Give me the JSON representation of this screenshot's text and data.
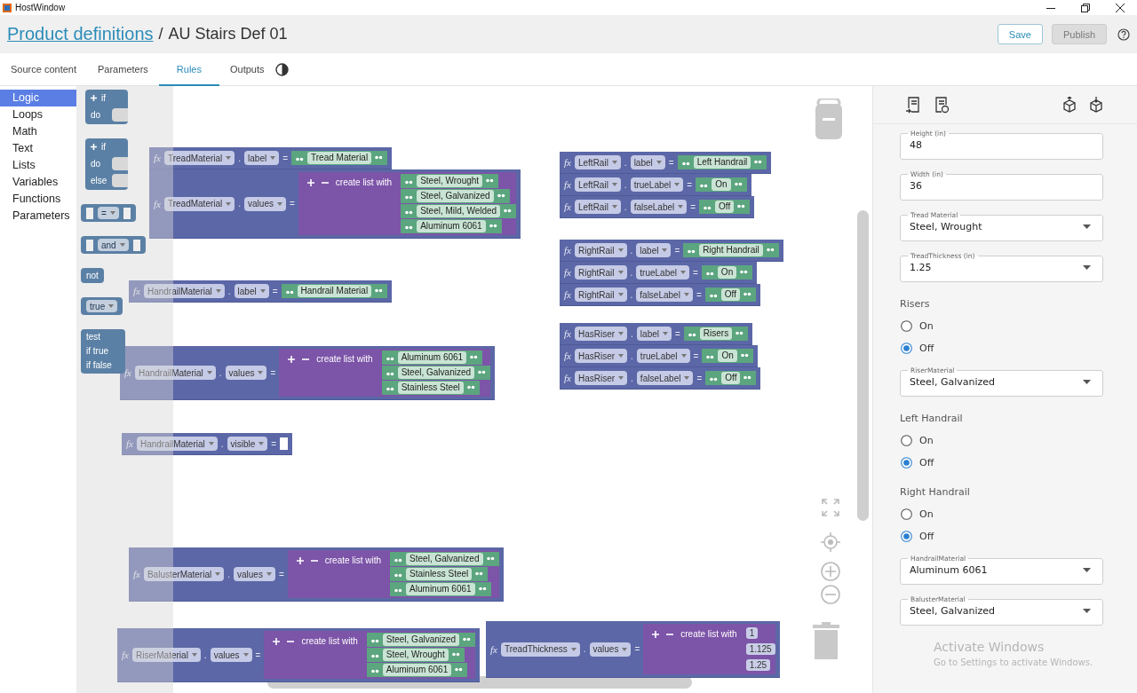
{
  "window": {
    "title": "HostWindow"
  },
  "header": {
    "link": "Product definitions",
    "separator": "/",
    "title": "AU Stairs Def 01",
    "buttons": [
      {
        "label": "Save",
        "disabled": false
      },
      {
        "label": "Publish",
        "disabled": true
      }
    ]
  },
  "tabs": [
    {
      "label": "Source content",
      "selected": false
    },
    {
      "label": "Parameters",
      "selected": false
    },
    {
      "label": "Rules",
      "selected": true
    },
    {
      "label": "Outputs",
      "selected": false
    }
  ],
  "toolbox": [
    {
      "label": "Logic",
      "selected": true
    },
    {
      "label": "Loops",
      "selected": false
    },
    {
      "label": "Math",
      "selected": false
    },
    {
      "label": "Text",
      "selected": false
    },
    {
      "label": "Lists",
      "selected": false
    },
    {
      "label": "Variables",
      "selected": false
    },
    {
      "label": "Functions",
      "selected": false
    },
    {
      "label": "Parameters",
      "selected": false
    }
  ],
  "flyout": [
    {
      "kind": "if",
      "labels": [
        "if",
        "do"
      ]
    },
    {
      "kind": "if_else",
      "labels": [
        "if",
        "do",
        "else"
      ]
    },
    {
      "kind": "compare",
      "op": "="
    },
    {
      "kind": "logic_op",
      "op": "and"
    },
    {
      "kind": "not",
      "label": "not"
    },
    {
      "kind": "boolean",
      "value": "true"
    },
    {
      "kind": "ternary",
      "labels": [
        "test",
        "if true",
        "if false"
      ]
    }
  ],
  "canvas": {
    "groups": [
      {
        "rows": [
          {
            "icon": "fx",
            "object": "TreadMaterial",
            "dot": ".",
            "property": "label",
            "op": "=",
            "value": {
              "kind": "text",
              "text": "Tread Material"
            }
          },
          {
            "icon": "fx",
            "object": "TreadMaterial",
            "dot": ".",
            "property": "values",
            "op": "=",
            "value": {
              "kind": "list",
              "label": "create list with",
              "items": [
                {
                  "kind": "text",
                  "text": "Steel, Wrought"
                },
                {
                  "kind": "text",
                  "text": "Steel, Galvanized"
                },
                {
                  "kind": "text",
                  "text": "Steel, Mild, Welded"
                },
                {
                  "kind": "text",
                  "text": "Aluminum 6061"
                }
              ]
            }
          }
        ]
      },
      {
        "rows": [
          {
            "icon": "fx",
            "object": "HandrailMaterial",
            "dot": ".",
            "property": "label",
            "op": "=",
            "value": {
              "kind": "text",
              "text": "Handrail Material"
            }
          }
        ]
      },
      {
        "rows": [
          {
            "icon": "fx",
            "object": "HandrailMaterial",
            "dot": ".",
            "property": "values",
            "op": "=",
            "value": {
              "kind": "list",
              "label": "create list with",
              "items": [
                {
                  "kind": "text",
                  "text": "Aluminum 6061"
                },
                {
                  "kind": "text",
                  "text": "Steel, Galvanized"
                },
                {
                  "kind": "text",
                  "text": "Stainless Steel"
                }
              ]
            }
          }
        ]
      },
      {
        "rows": [
          {
            "icon": "fx",
            "object": "HandrailMaterial",
            "dot": ".",
            "property": "visible",
            "op": "=",
            "value": {
              "kind": "empty"
            }
          }
        ]
      },
      {
        "rows": [
          {
            "icon": "fx",
            "object": "BalusterMaterial",
            "dot": ".",
            "property": "values",
            "op": "=",
            "value": {
              "kind": "list",
              "label": "create list with",
              "items": [
                {
                  "kind": "text",
                  "text": "Steel, Galvanized"
                },
                {
                  "kind": "text",
                  "text": "Stainless Steel"
                },
                {
                  "kind": "text",
                  "text": "Aluminum 6061"
                }
              ]
            }
          }
        ]
      },
      {
        "rows": [
          {
            "icon": "fx",
            "object": "RiserMaterial",
            "dot": ".",
            "property": "values",
            "op": "=",
            "value": {
              "kind": "list",
              "label": "create list with",
              "items": [
                {
                  "kind": "text",
                  "text": "Steel, Galvanized"
                },
                {
                  "kind": "text",
                  "text": "Steel, Wrought"
                },
                {
                  "kind": "text",
                  "text": "Aluminum 6061"
                }
              ]
            }
          }
        ]
      },
      {
        "rows": [
          {
            "icon": "fx",
            "object": "LeftRail",
            "dot": ".",
            "property": "label",
            "op": "=",
            "value": {
              "kind": "text",
              "text": "Left Handrail"
            }
          },
          {
            "icon": "fx",
            "object": "LeftRail",
            "dot": ".",
            "property": "trueLabel",
            "op": "=",
            "value": {
              "kind": "text",
              "text": "On"
            }
          },
          {
            "icon": "fx",
            "object": "LeftRail",
            "dot": ".",
            "property": "falseLabel",
            "op": "=",
            "value": {
              "kind": "text",
              "text": "Off"
            }
          }
        ]
      },
      {
        "rows": [
          {
            "icon": "fx",
            "object": "RightRail",
            "dot": ".",
            "property": "label",
            "op": "=",
            "value": {
              "kind": "text",
              "text": "Right Handrail"
            }
          },
          {
            "icon": "fx",
            "object": "RightRail",
            "dot": ".",
            "property": "trueLabel",
            "op": "=",
            "value": {
              "kind": "text",
              "text": "On"
            }
          },
          {
            "icon": "fx",
            "object": "RightRail",
            "dot": ".",
            "property": "falseLabel",
            "op": "=",
            "value": {
              "kind": "text",
              "text": "Off"
            }
          }
        ]
      },
      {
        "rows": [
          {
            "icon": "fx",
            "object": "HasRiser",
            "dot": ".",
            "property": "label",
            "op": "=",
            "value": {
              "kind": "text",
              "text": "Risers"
            }
          },
          {
            "icon": "fx",
            "object": "HasRiser",
            "dot": ".",
            "property": "trueLabel",
            "op": "=",
            "value": {
              "kind": "text",
              "text": "On"
            }
          },
          {
            "icon": "fx",
            "object": "HasRiser",
            "dot": ".",
            "property": "falseLabel",
            "op": "=",
            "value": {
              "kind": "text",
              "text": "Off"
            }
          }
        ]
      },
      {
        "rows": [
          {
            "icon": "fx",
            "object": "TreadThickness",
            "dot": ".",
            "property": "values",
            "op": "=",
            "value": {
              "kind": "list",
              "label": "create list with",
              "items": [
                {
                  "kind": "number",
                  "text": "1"
                },
                {
                  "kind": "number",
                  "text": "1.125"
                },
                {
                  "kind": "number",
                  "text": "1.25"
                }
              ]
            }
          }
        ]
      }
    ]
  },
  "panel": {
    "controls": [
      {
        "kind": "input",
        "label": "Height (in)",
        "value": "48"
      },
      {
        "kind": "input",
        "label": "Width (in)",
        "value": "36"
      },
      {
        "kind": "select",
        "label": "Tread Material",
        "value": "Steel, Wrought"
      },
      {
        "kind": "select",
        "label": "TreadThickness (in)",
        "value": "1.25"
      },
      {
        "kind": "radio",
        "label": "Risers",
        "options": [
          {
            "label": "On",
            "selected": false
          },
          {
            "label": "Off",
            "selected": true
          }
        ]
      },
      {
        "kind": "select",
        "label": "RiserMaterial",
        "value": "Steel, Galvanized"
      },
      {
        "kind": "radio",
        "label": "Left Handrail",
        "options": [
          {
            "label": "On",
            "selected": false
          },
          {
            "label": "Off",
            "selected": true
          }
        ]
      },
      {
        "kind": "radio",
        "label": "Right Handrail",
        "options": [
          {
            "label": "On",
            "selected": false
          },
          {
            "label": "Off",
            "selected": true
          }
        ]
      },
      {
        "kind": "select",
        "label": "HandrailMaterial",
        "value": "Aluminum 6061"
      },
      {
        "kind": "select",
        "label": "BalusterMaterial",
        "value": "Steel, Galvanized"
      }
    ]
  },
  "os_notice": {
    "title": "Activate Windows",
    "text": "Go to Settings to activate Windows."
  }
}
